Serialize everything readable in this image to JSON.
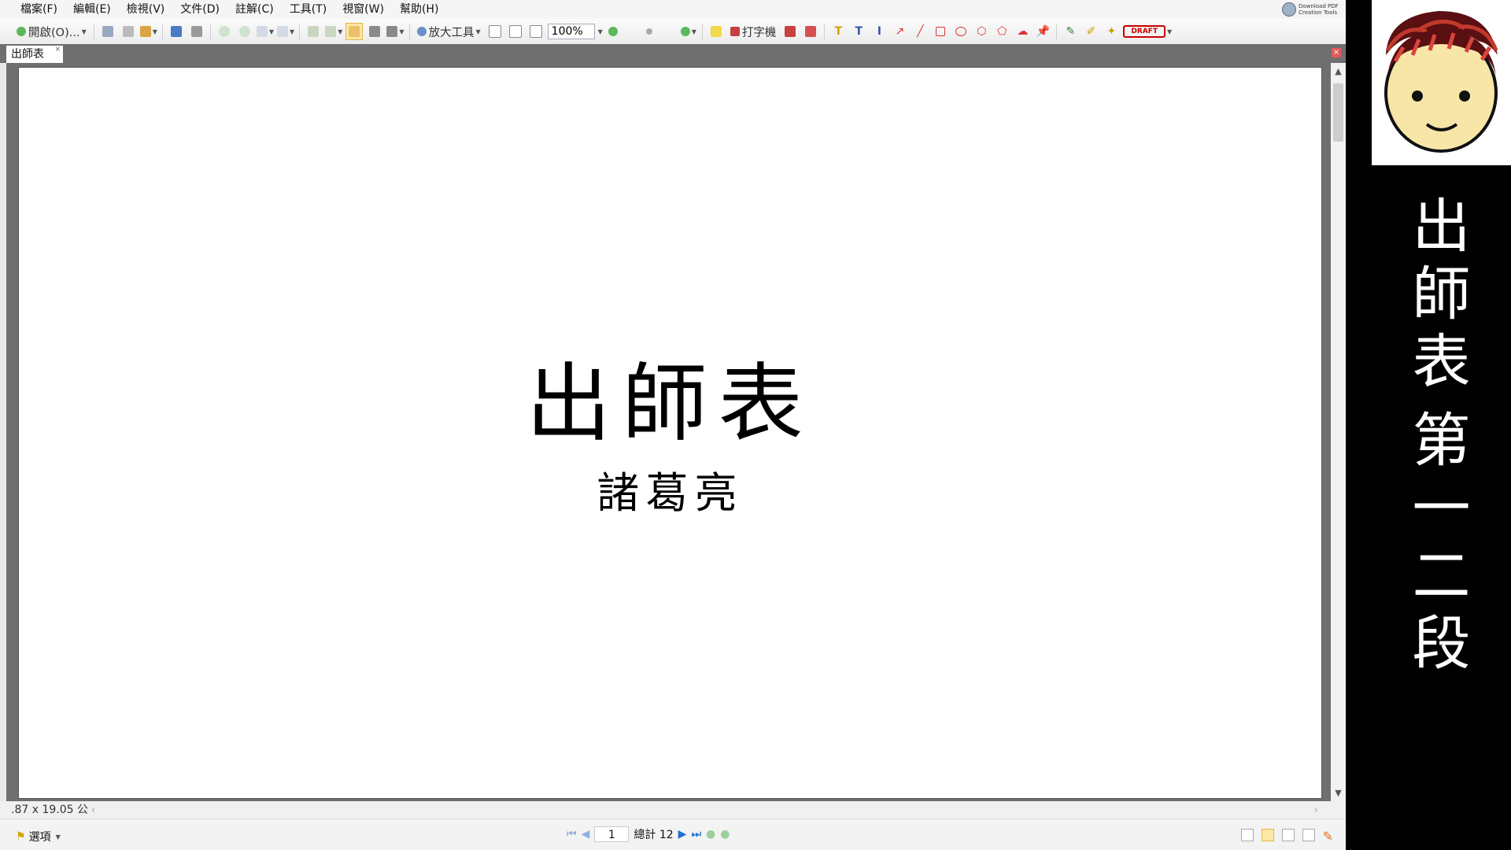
{
  "menubar": {
    "items": [
      "檔案(F)",
      "編輯(E)",
      "檢視(V)",
      "文件(D)",
      "註解(C)",
      "工具(T)",
      "視窗(W)",
      "幫助(H)"
    ],
    "download_badge": "Download PDF Creation Tools"
  },
  "toolbar": {
    "open_label": "開啟(O)...",
    "zoom_tool_label": "放大工具",
    "zoom_value": "100%",
    "typewriter_label": "打字機",
    "draft_stamp": "DRAFT"
  },
  "tabs": {
    "document_tab": "出師表"
  },
  "document": {
    "title": "出師表",
    "author": "諸葛亮"
  },
  "status": {
    "page_size": ".87 x 19.05 公"
  },
  "navigation": {
    "options_label": "選項",
    "current_page": "1",
    "total_label": "總計 12"
  },
  "side_panel": {
    "vertical_title": "出師表第一二段"
  },
  "colors": {
    "app_background": "#f0f0f0",
    "workspace_gray": "#6f6f6f",
    "side_panel_background": "#000000",
    "side_panel_text": "#ffffff",
    "nav_blue": "#1f6fd1",
    "draft_red": "#cc0000"
  }
}
